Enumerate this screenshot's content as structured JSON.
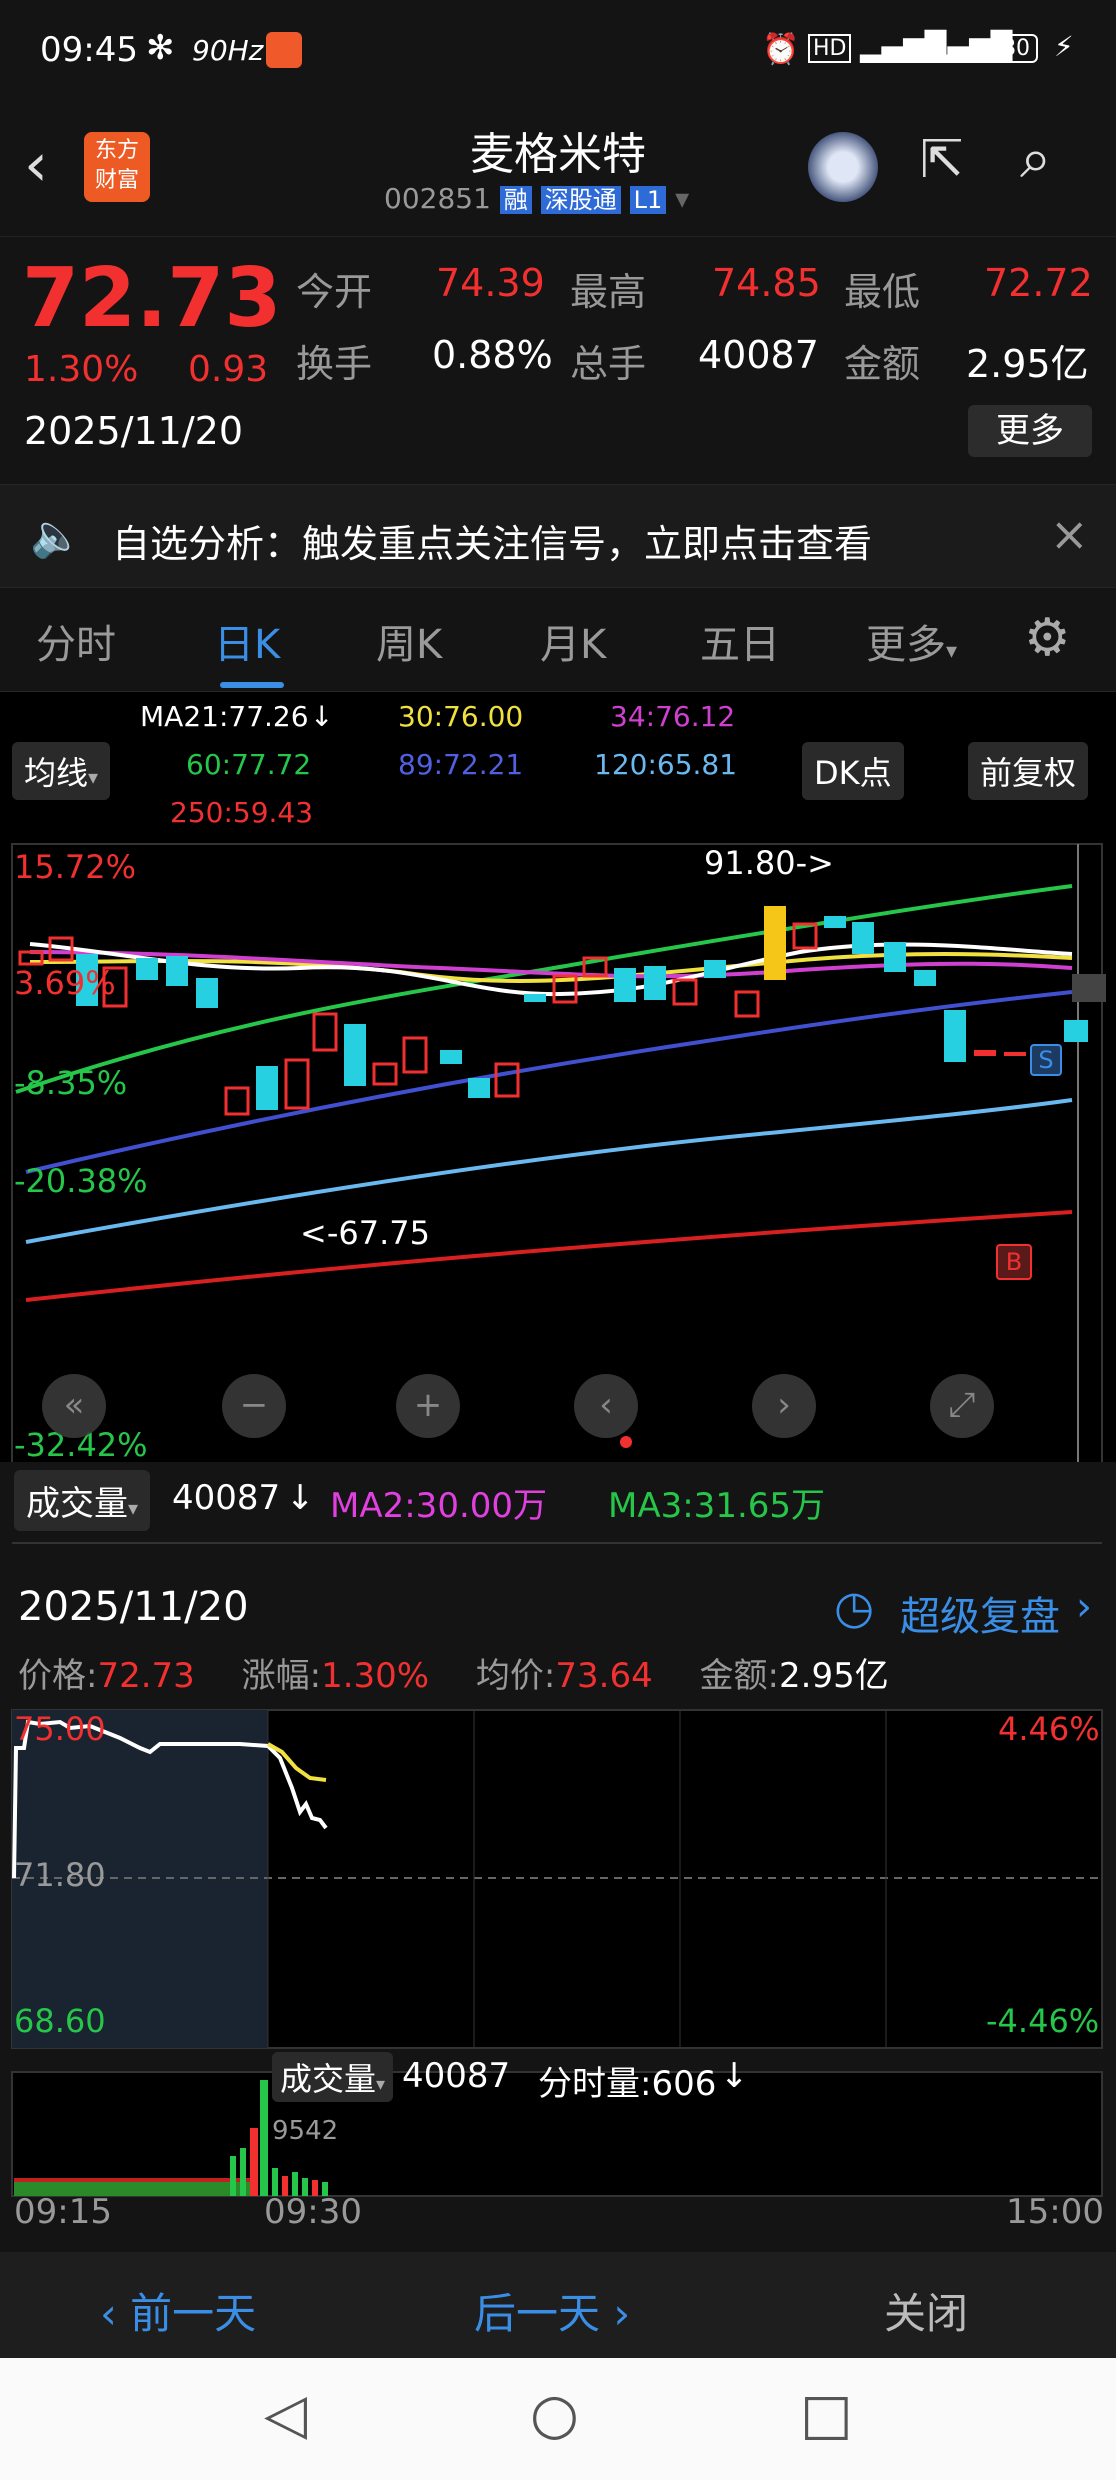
{
  "status": {
    "time": "09:45",
    "refresh": "90Hz",
    "battery": "80"
  },
  "header": {
    "logo_line1": "东方",
    "logo_line2": "财富",
    "stock_name": "麦格米特",
    "stock_code": "002851",
    "tag_rong": "融",
    "tag_sgt": "深股通",
    "tag_l1": "L1"
  },
  "quote": {
    "price": "72.73",
    "change_pct": "1.30%",
    "change": "0.93",
    "date": "2025/11/20",
    "open_label": "今开",
    "open": "74.39",
    "high_label": "最高",
    "high": "74.85",
    "low_label": "最低",
    "low": "72.72",
    "turnover_label": "换手",
    "turnover": "0.88%",
    "vol_label": "总手",
    "vol": "40087",
    "amount_label": "金额",
    "amount": "2.95亿",
    "more": "更多"
  },
  "notice": {
    "text": "自选分析：触发重点关注信号，立即点击查看"
  },
  "tabs": [
    "分时",
    "日K",
    "周K",
    "月K",
    "五日",
    "更多"
  ],
  "active_tab": "日K",
  "ma": {
    "selector": "均线",
    "ma21": "MA21:77.26",
    "ma30": "30:76.00",
    "ma34": "34:76.12",
    "ma60": "60:77.72",
    "ma89": "89:72.21",
    "ma120": "120:65.81",
    "ma250": "250:59.43",
    "dk": "DK点",
    "fq": "前复权"
  },
  "chart_labels": {
    "p1": "15.72%",
    "p2": "3.69%",
    "p3": "-8.35%",
    "p4": "-20.38%",
    "p5": "-32.42%",
    "high_mark": "91.80->",
    "low_mark": "<-67.75",
    "sell": "S",
    "buy": "B"
  },
  "volume_row": {
    "label": "成交量",
    "vol": "40087",
    "ma2": "MA2:30.00万",
    "ma3": "MA3:31.65万"
  },
  "review": {
    "date": "2025/11/20",
    "replay": "超级复盘",
    "price_label": "价格:",
    "price": "72.73",
    "chg_label": "涨幅:",
    "chg": "1.30%",
    "avg_label": "均价:",
    "avg": "73.64",
    "amt_label": "金额:",
    "amt": "2.95亿",
    "y_top": "75.00",
    "y_mid": "71.80",
    "y_bot": "68.60",
    "pct_top": "4.46%",
    "pct_bot": "-4.46%",
    "vol_label": "成交量",
    "vol": "40087",
    "tick_vol": "分时量:606",
    "vol_peak": "9542",
    "t_start": "09:15",
    "t_mid": "09:30",
    "t_end": "15:00"
  },
  "footer": {
    "prev": "前一天",
    "next": "后一天",
    "close": "关闭"
  }
}
